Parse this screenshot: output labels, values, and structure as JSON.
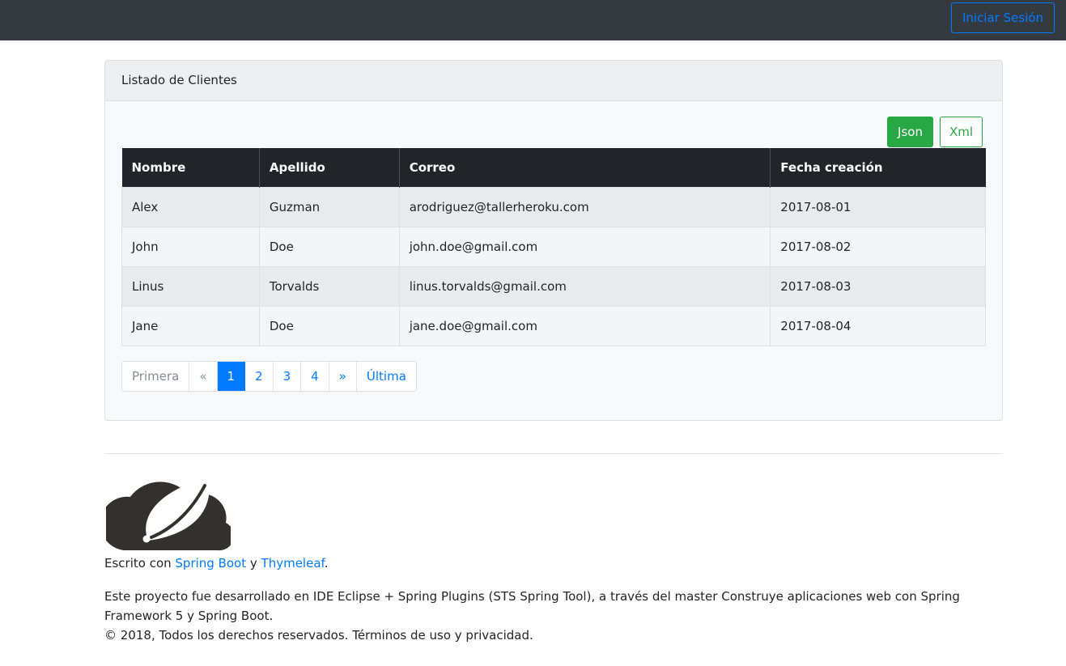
{
  "navbar": {
    "login_label": "Iniciar Sesión"
  },
  "card": {
    "title": "Listado de Clientes",
    "json_label": "Json",
    "xml_label": "Xml"
  },
  "table": {
    "headers": [
      "Nombre",
      "Apellido",
      "Correo",
      "Fecha creación"
    ],
    "rows": [
      [
        "Alex",
        "Guzman",
        "arodriguez@tallerheroku.com",
        "2017-08-01"
      ],
      [
        "John",
        "Doe",
        "john.doe@gmail.com",
        "2017-08-02"
      ],
      [
        "Linus",
        "Torvalds",
        "linus.torvalds@gmail.com",
        "2017-08-03"
      ],
      [
        "Jane",
        "Doe",
        "jane.doe@gmail.com",
        "2017-08-04"
      ]
    ]
  },
  "pagination": {
    "first": "Primera",
    "prev": "«",
    "pages": [
      "1",
      "2",
      "3",
      "4"
    ],
    "current_page": "1",
    "next": "»",
    "last": "Última"
  },
  "footer": {
    "written_prefix": "Escrito con ",
    "spring_boot_link": "Spring Boot",
    "and": " y ",
    "thymeleaf_link": "Thymeleaf",
    "period": ".",
    "description": "Este proyecto fue desarrollado en IDE Eclipse + Spring Plugins (STS Spring Tool), a través del master Construye aplicaciones web con Spring Framework 5 y Spring Boot.",
    "copyright": "© 2018, Todos los derechos reservados. Términos de uso y privacidad."
  },
  "icons": {
    "logo": "spring-leaf-cloud-logo"
  },
  "colors": {
    "navbar": "#343a40",
    "primary": "#007bff",
    "success": "#28a745",
    "table_header": "#212529",
    "logo": "#34302d"
  }
}
